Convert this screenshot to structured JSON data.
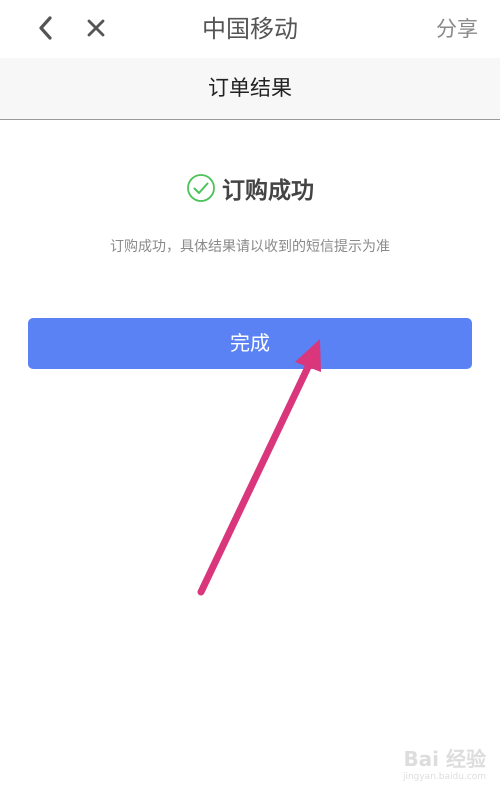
{
  "header": {
    "title": "中国移动",
    "share_label": "分享",
    "back_icon": "chevron-left-icon",
    "close_icon": "close-icon"
  },
  "subheader": {
    "title": "订单结果"
  },
  "result": {
    "status_icon": "check-circle-icon",
    "title": "订购成功",
    "description": "订购成功，具体结果请以收到的短信提示为准"
  },
  "actions": {
    "done_label": "完成"
  },
  "annotation": {
    "arrow_color": "#d9367c"
  },
  "watermark": {
    "logo": "Bai 经验",
    "url": "jingyan.baidu.com"
  },
  "colors": {
    "primary_button": "#5a82f5",
    "success": "#4cc35a"
  }
}
